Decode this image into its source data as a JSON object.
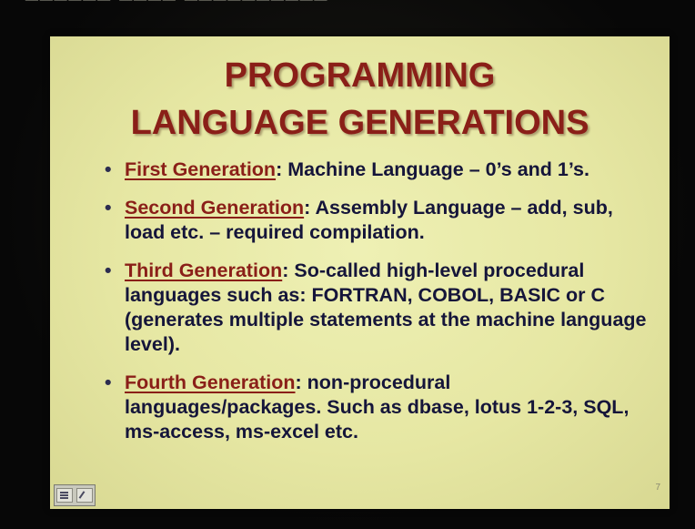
{
  "slide": {
    "title_line1": "PROGRAMMING",
    "title_line2": "LANGUAGE GENERATIONS",
    "bullet_symbol": "•",
    "bullets": [
      {
        "heading": "First Generation",
        "text": ": Machine Language – 0’s and 1’s."
      },
      {
        "heading": "Second Generation",
        "text": ": Assembly Language – add, sub, load etc. – required compilation."
      },
      {
        "heading": "Third Generation",
        "text": ": So-called high-level procedural languages such as: FORTRAN, COBOL, BASIC or C (generates multiple statements at the machine language level)."
      },
      {
        "heading": "Fourth Generation",
        "text": ": non-procedural languages/packages. Such as dbase, lotus 1-2-3, SQL, ms-access, ms-excel etc."
      }
    ],
    "page_number": "7"
  },
  "icons": {
    "slide_menu": "slide-menu-icon",
    "pen": "pen-icon"
  }
}
